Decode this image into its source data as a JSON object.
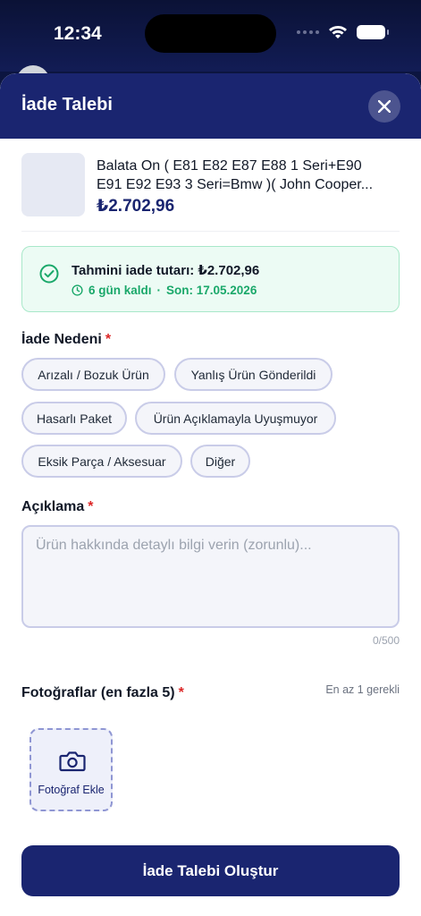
{
  "status_bar": {
    "time": "12:34"
  },
  "sheet": {
    "title": "İade Talebi",
    "close_icon": "close-icon"
  },
  "product": {
    "name_line1": "Balata On   ( E81 E82 E87 E88 1 Seri+E90",
    "name_line2": "E91 E92 E93 3 Seri=Bmw )( John Cooper...",
    "price": "₺2.702,96"
  },
  "refund": {
    "title": "Tahmini iade tutarı: ₺2.702,96",
    "days_left": "6 gün kaldı",
    "separator": "·",
    "deadline": "Son: 17.05.2026",
    "accent_color": "#1aa86a"
  },
  "reason": {
    "label": "İade Nedeni",
    "required_mark": "*",
    "options": [
      "Arızalı / Bozuk Ürün",
      "Yanlış Ürün Gönderildi",
      "Hasarlı Paket",
      "Ürün Açıklamayla Uyuşmuyor",
      "Eksik Parça / Aksesuar",
      "Diğer"
    ]
  },
  "description": {
    "label": "Açıklama",
    "required_mark": "*",
    "placeholder": "Ürün hakkında detaylı bilgi verin (zorunlu)...",
    "value": "",
    "char_count": "0/500"
  },
  "photos": {
    "label": "Fotoğraflar (en fazla 5)",
    "required_mark": "*",
    "hint": "En az 1 gerekli",
    "add_label": "Fotoğraf Ekle"
  },
  "submit": {
    "label": "İade Talebi Oluştur"
  },
  "colors": {
    "primary": "#1a2570",
    "required": "#dc2626"
  }
}
